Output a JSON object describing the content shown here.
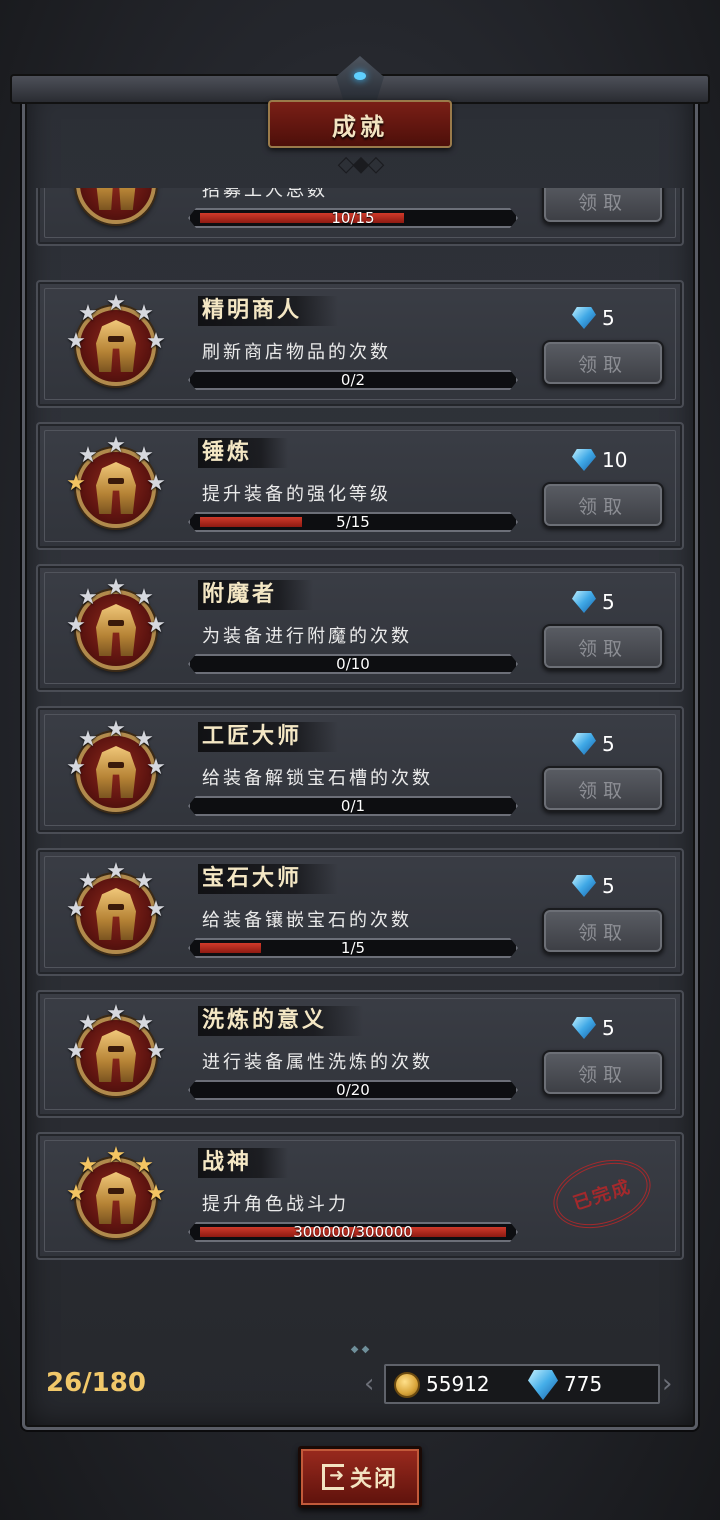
{
  "header": {
    "title": "成就"
  },
  "achievements": [
    {
      "title": "",
      "desc": "招募工人总数",
      "progress_text": "10/15",
      "progress": 0.667,
      "reward": "",
      "claim_label": "领取",
      "stars": 5,
      "gold_stars": 1,
      "completed": false
    },
    {
      "title": "精明商人",
      "desc": "刷新商店物品的次数",
      "progress_text": "0/2",
      "progress": 0,
      "reward": "5",
      "claim_label": "领取",
      "stars": 5,
      "gold_stars": 0,
      "completed": false
    },
    {
      "title": "锤炼",
      "desc": "提升装备的强化等级",
      "progress_text": "5/15",
      "progress": 0.333,
      "reward": "10",
      "claim_label": "领取",
      "stars": 5,
      "gold_stars": 1,
      "completed": false
    },
    {
      "title": "附魔者",
      "desc": "为装备进行附魔的次数",
      "progress_text": "0/10",
      "progress": 0,
      "reward": "5",
      "claim_label": "领取",
      "stars": 5,
      "gold_stars": 0,
      "completed": false
    },
    {
      "title": "工匠大师",
      "desc": "给装备解锁宝石槽的次数",
      "progress_text": "0/1",
      "progress": 0,
      "reward": "5",
      "claim_label": "领取",
      "stars": 5,
      "gold_stars": 0,
      "completed": false
    },
    {
      "title": "宝石大师",
      "desc": "给装备镶嵌宝石的次数",
      "progress_text": "1/5",
      "progress": 0.2,
      "reward": "5",
      "claim_label": "领取",
      "stars": 5,
      "gold_stars": 0,
      "completed": false
    },
    {
      "title": "洗炼的意义",
      "desc": "进行装备属性洗炼的次数",
      "progress_text": "0/20",
      "progress": 0,
      "reward": "5",
      "claim_label": "领取",
      "stars": 5,
      "gold_stars": 0,
      "completed": false
    },
    {
      "title": "战神",
      "desc": "提升角色战斗力",
      "progress_text": "300000/300000",
      "progress": 1,
      "reward": "",
      "claim_label": "",
      "stars": 5,
      "gold_stars": 5,
      "completed": true,
      "stamp_label": "已完成"
    }
  ],
  "footer": {
    "count": "26/180",
    "coins": "55912",
    "gems": "775",
    "close_label": "关闭"
  },
  "icons": {
    "coin": "coin-icon",
    "gem": "gem-icon",
    "close": "exit-icon",
    "star": "star-icon",
    "badge": "helmet-icon"
  },
  "colors": {
    "accent_red": "#8e1a12",
    "gold": "#f1c86a",
    "gem_blue": "#3fa8e6",
    "stamp_red": "#b0282a"
  }
}
